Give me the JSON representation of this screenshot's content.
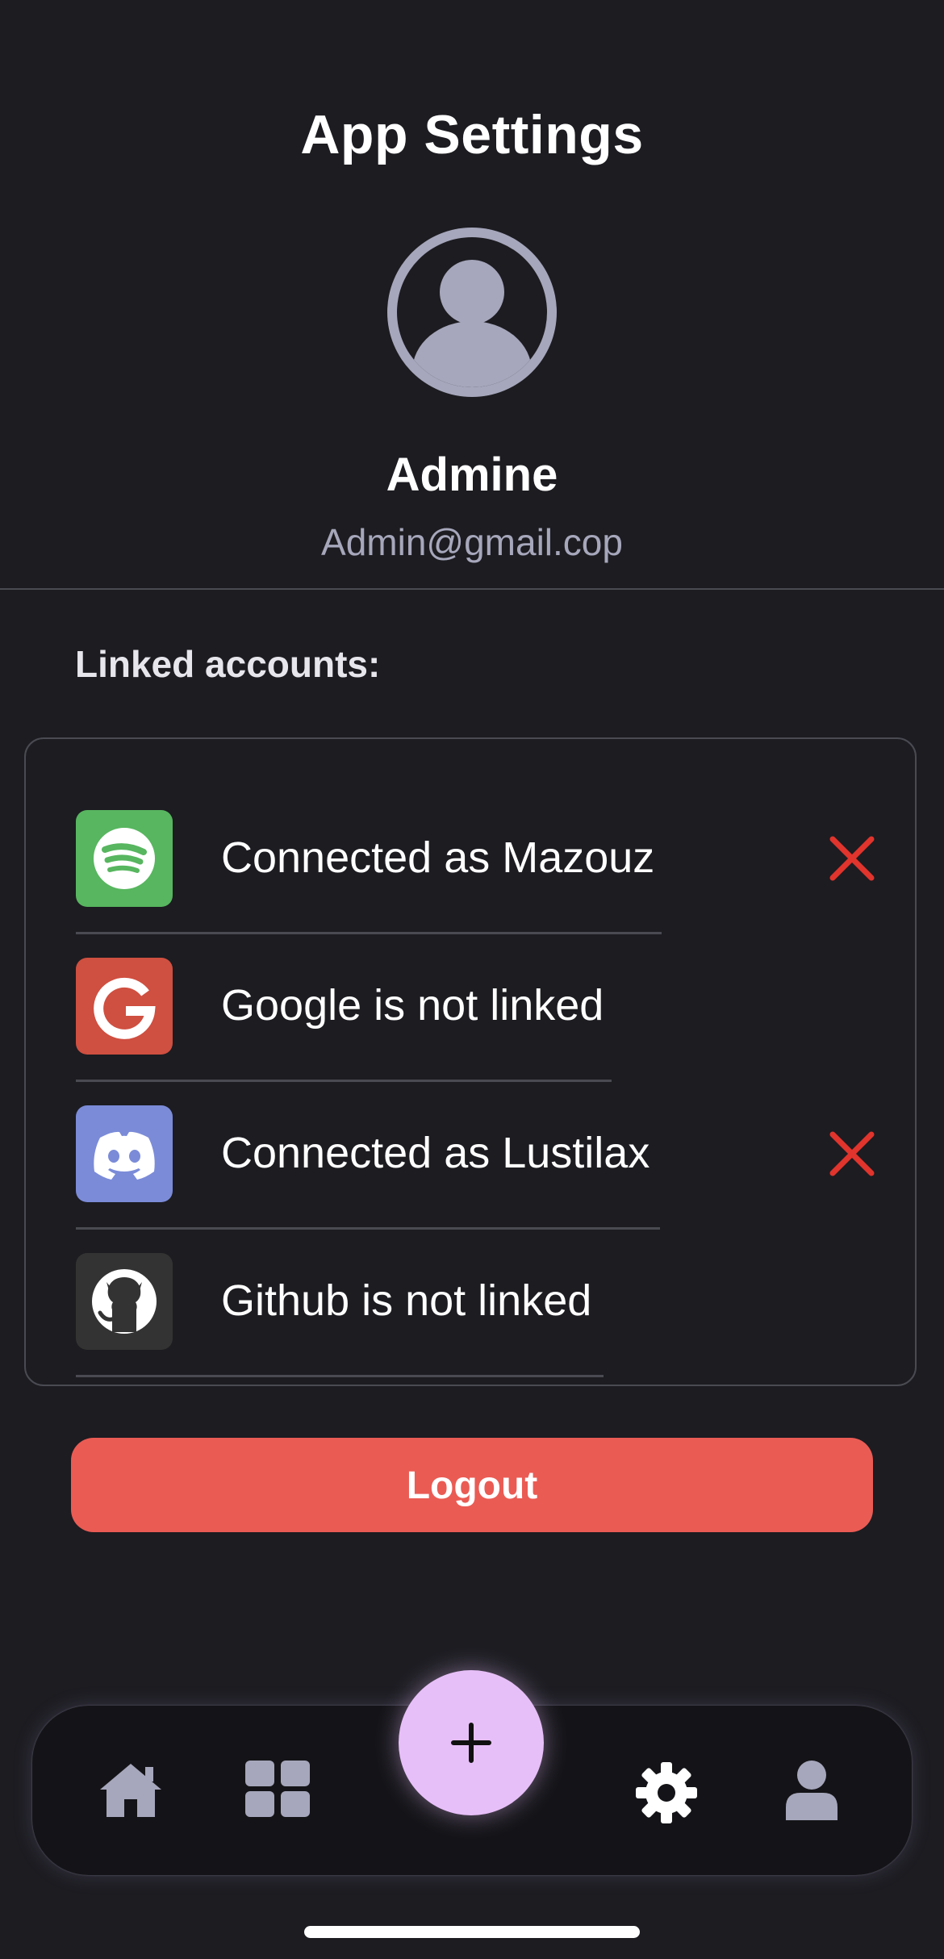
{
  "header": {
    "title": "App Settings"
  },
  "profile": {
    "name": "Admine",
    "email": "Admin@gmail.cop",
    "avatar_icon": "user-avatar-icon"
  },
  "linked_accounts": {
    "label": "Linked accounts:",
    "items": [
      {
        "service": "spotify",
        "icon": "spotify-icon",
        "text": "Connected as Mazouz",
        "linked": true,
        "color": "#57b65f"
      },
      {
        "service": "google",
        "icon": "google-icon",
        "text": "Google is not linked",
        "linked": false,
        "color": "#cf4f40"
      },
      {
        "service": "discord",
        "icon": "discord-icon",
        "text": "Connected as Lustilax",
        "linked": true,
        "color": "#7b8bd8"
      },
      {
        "service": "github",
        "icon": "github-icon",
        "text": "Github is not linked",
        "linked": false,
        "color": "#333333"
      }
    ],
    "unlink_icon": "close-icon",
    "unlink_color": "#e0342c"
  },
  "actions": {
    "logout_label": "Logout",
    "logout_color": "#ea5b54"
  },
  "tab_bar": {
    "items": [
      {
        "name": "home",
        "icon": "home-icon"
      },
      {
        "name": "dashboard",
        "icon": "grid-icon"
      },
      {
        "name": "add",
        "icon": "plus-icon"
      },
      {
        "name": "settings",
        "icon": "gear-icon",
        "active": true
      },
      {
        "name": "profile",
        "icon": "user-icon"
      }
    ],
    "fab_color": "#e7bff8"
  }
}
